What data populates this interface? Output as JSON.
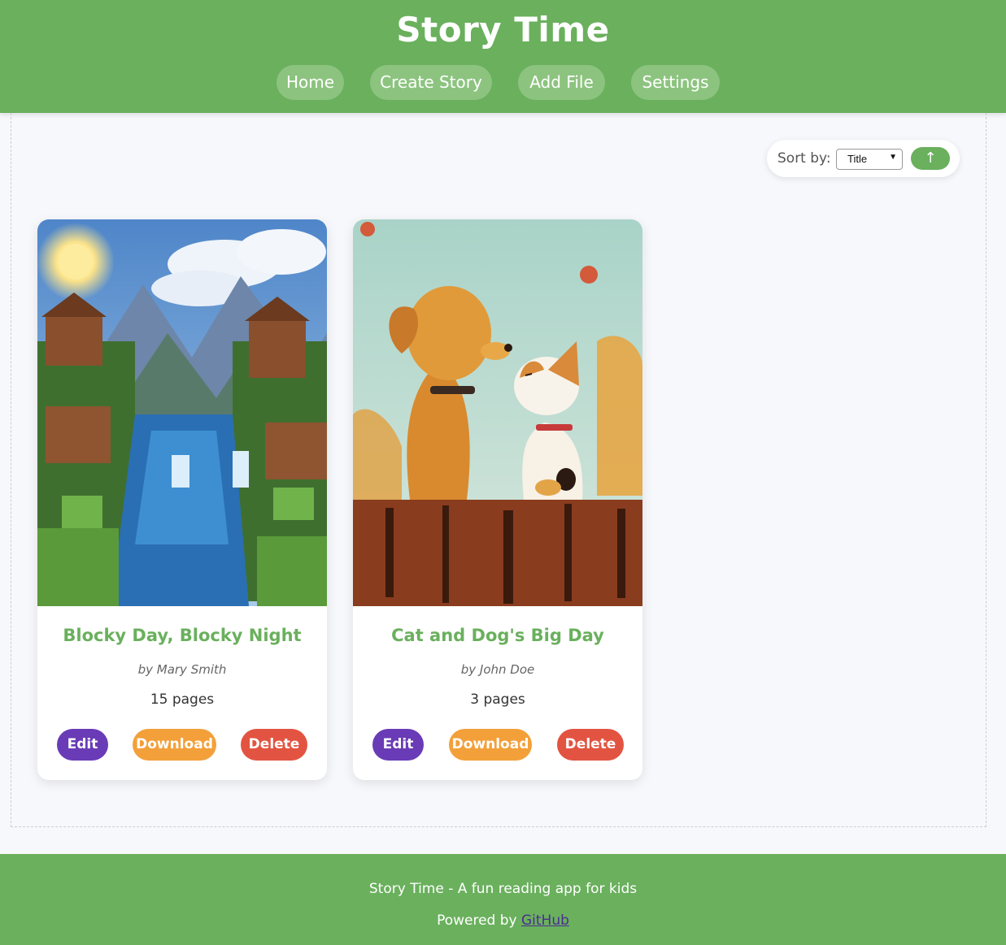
{
  "header": {
    "title": "Story Time",
    "nav": [
      {
        "label": "Home"
      },
      {
        "label": "Create Story"
      },
      {
        "label": "Add File"
      },
      {
        "label": "Settings"
      }
    ]
  },
  "sort": {
    "label": "Sort by:",
    "selected": "Title",
    "order_icon": "↑"
  },
  "stories": [
    {
      "title": "Blocky Day, Blocky Night",
      "author": "by Mary Smith",
      "pages": "15 pages",
      "cover": "voxel-landscape-with-waterfall",
      "actions": {
        "edit": "Edit",
        "download": "Download",
        "delete": "Delete"
      }
    },
    {
      "title": "Cat and Dog's Big Day",
      "author": "by John Doe",
      "pages": "3 pages",
      "cover": "dog-and-cat-on-fence",
      "actions": {
        "edit": "Edit",
        "download": "Download",
        "delete": "Delete"
      }
    }
  ],
  "footer": {
    "tagline": "Story Time - A fun reading app for kids",
    "powered_prefix": "Powered by ",
    "powered_link": "GitHub"
  },
  "colors": {
    "primary": "#6ab05d",
    "edit": "#6a3bb6",
    "download": "#f3a03a",
    "delete": "#e25441"
  }
}
